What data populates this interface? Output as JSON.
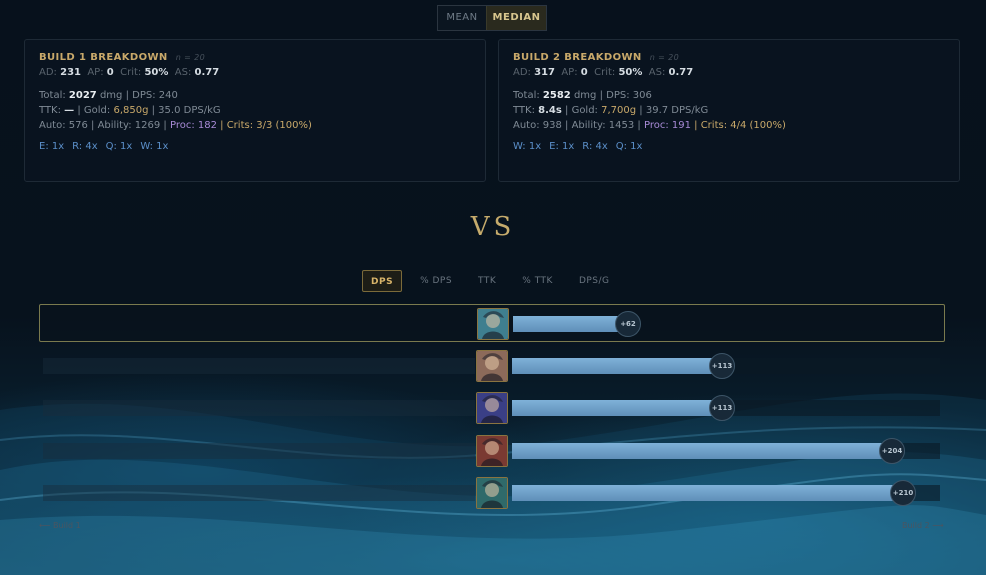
{
  "stat_toggle": {
    "options": [
      "MEAN",
      "MEDIAN"
    ],
    "selected": "MEDIAN"
  },
  "builds": [
    {
      "title": "BUILD 1 BREAKDOWN",
      "n": "n = 20",
      "ad_label": "AD:",
      "ad": "231",
      "ap_label": "AP:",
      "ap": "0",
      "crit_label": "Crit:",
      "crit": "50%",
      "as_label": "AS:",
      "as": "0.77",
      "total_label": "Total:",
      "total": "2027",
      "total_suffix": "dmg | DPS: 240",
      "ttk_label": "TTK:",
      "ttk": "—",
      "gold_label": "|  Gold:",
      "gold": "6,850g",
      "dps_per_gold": "|  35.0 DPS/kG",
      "auto": "Auto: 576",
      "ability": "| Ability: 1269 |",
      "proc": "Proc: 182",
      "crits": "| Crits: 3/3 (100%)",
      "skills": [
        "E: 1x",
        "R: 4x",
        "Q: 1x",
        "W: 1x"
      ]
    },
    {
      "title": "BUILD 2 BREAKDOWN",
      "n": "n = 20",
      "ad_label": "AD:",
      "ad": "317",
      "ap_label": "AP:",
      "ap": "0",
      "crit_label": "Crit:",
      "crit": "50%",
      "as_label": "AS:",
      "as": "0.77",
      "total_label": "Total:",
      "total": "2582",
      "total_suffix": "dmg | DPS: 306",
      "ttk_label": "TTK:",
      "ttk": "8.4s",
      "gold_label": "|  Gold:",
      "gold": "7,700g",
      "dps_per_gold": "|  39.7 DPS/kG",
      "auto": "Auto: 938",
      "ability": "| Ability: 1453 |",
      "proc": "Proc: 191",
      "crits": "| Crits: 4/4 (100%)",
      "skills": [
        "W: 1x",
        "E: 1x",
        "R: 4x",
        "Q: 1x"
      ]
    }
  ],
  "vs_text": "VS",
  "metric_tabs": [
    "DPS",
    "% DPS",
    "TTK",
    "% TTK",
    "DPS/G"
  ],
  "active_metric": "DPS",
  "comparison_rows": [
    {
      "delta": "+62",
      "value": 62,
      "selected": true,
      "portrait_color": "#3f7f8f"
    },
    {
      "delta": "+113",
      "value": 113,
      "selected": false,
      "portrait_color": "#8c6a5a"
    },
    {
      "delta": "+113",
      "value": 113,
      "selected": false,
      "portrait_color": "#3a3f86"
    },
    {
      "delta": "+204",
      "value": 204,
      "selected": false,
      "portrait_color": "#7a3a32"
    },
    {
      "delta": "+210",
      "value": 210,
      "selected": false,
      "portrait_color": "#2f6a6a"
    }
  ],
  "footer": {
    "left": "⟵ Build 1",
    "right": "Build 2 ⟶"
  }
}
